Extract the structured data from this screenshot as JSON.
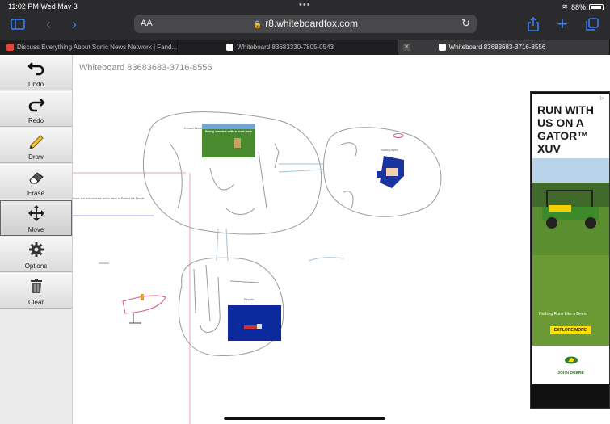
{
  "status_bar": {
    "time_date": "11:02 PM  Wed May 3",
    "battery": "88%",
    "dots": "•••"
  },
  "address_bar": {
    "text_size_label": "AA",
    "url": "r8.whiteboardfox.com"
  },
  "tabs": [
    {
      "label": "Discuss Everything About Sonic News Network | Fand...",
      "active": false,
      "favicon_color": "#e1483b"
    },
    {
      "label": "Whiteboard 83683330-7805-0543",
      "active": false,
      "favicon_color": "#ffffff"
    },
    {
      "label": "Whiteboard 83683683-3716-8556",
      "active": true,
      "favicon_color": "#ffffff"
    }
  ],
  "toolbar": {
    "items": [
      {
        "label": "Undo",
        "icon": "undo-icon"
      },
      {
        "label": "Redo",
        "icon": "redo-icon"
      },
      {
        "label": "Draw",
        "icon": "pencil-icon"
      },
      {
        "label": "Erase",
        "icon": "eraser-icon"
      },
      {
        "label": "Move",
        "icon": "move-icon",
        "active": true
      },
      {
        "label": "Options",
        "icon": "gear-icon"
      },
      {
        "label": "Clear",
        "icon": "trash-icon"
      }
    ]
  },
  "board": {
    "title": "Whiteboard 83683683-3716-8556",
    "labels": {
      "crowd": "Crowd Level",
      "sonic": "Sonic Level",
      "people": "People",
      "left_note": "Sonic but one universe and is there to Protect the People"
    },
    "caption_on_image": "Being created with a mod here"
  },
  "ad": {
    "headline": "RUN WITH US ON A GATOR™ XUV",
    "tagline": "Nothing Runs Like a Deere",
    "cta": "EXPLORE MORE",
    "brand": "JOHN DEERE",
    "brand_color": "#367c2b",
    "cta_color": "#ffde00"
  },
  "colors": {
    "accent": "#3b82f6",
    "chrome_bg": "#2b2b2d"
  }
}
